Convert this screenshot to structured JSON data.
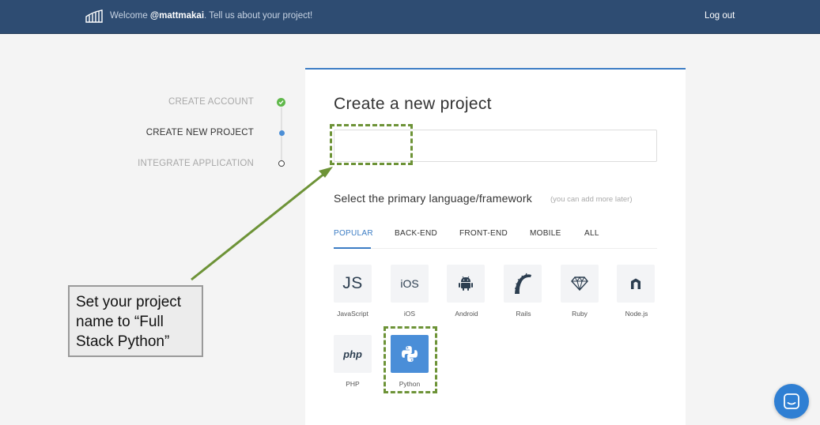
{
  "header": {
    "welcome_prefix": "Welcome ",
    "username": "@mattmakai",
    "welcome_suffix": ". Tell us about your project!",
    "logout_label": "Log out"
  },
  "steps": [
    {
      "label": "CREATE ACCOUNT",
      "status": "done"
    },
    {
      "label": "CREATE NEW PROJECT",
      "status": "active"
    },
    {
      "label": "INTEGRATE APPLICATION",
      "status": "todo"
    }
  ],
  "form": {
    "title": "Create a new project",
    "project_name_value": "",
    "language_heading": "Select the primary language/framework",
    "language_hint": "(you can add more later)"
  },
  "tabs": [
    {
      "label": "POPULAR",
      "active": true
    },
    {
      "label": "BACK-END"
    },
    {
      "label": "FRONT-END"
    },
    {
      "label": "MOBILE"
    },
    {
      "label": "ALL"
    }
  ],
  "frameworks": [
    {
      "label": "JavaScript",
      "icon": "javascript-icon",
      "glyph": "JS"
    },
    {
      "label": "iOS",
      "icon": "ios-icon",
      "glyph": "iOS"
    },
    {
      "label": "Android",
      "icon": "android-icon"
    },
    {
      "label": "Rails",
      "icon": "rails-icon"
    },
    {
      "label": "Ruby",
      "icon": "ruby-icon"
    },
    {
      "label": "Node.js",
      "icon": "nodejs-icon"
    },
    {
      "label": "PHP",
      "icon": "php-icon",
      "glyph": "php"
    },
    {
      "label": "Python",
      "icon": "python-icon",
      "selected": true
    }
  ],
  "annotation": {
    "callout_text": "Set your project name to “Full Stack Python”",
    "accent_color": "#6d9337"
  },
  "colors": {
    "header_bg": "#2e4c72",
    "accent": "#3c7dc4",
    "done_green": "#5fb84a"
  }
}
